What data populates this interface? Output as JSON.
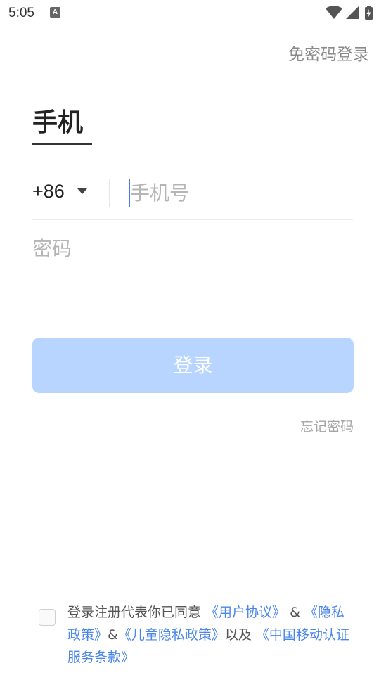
{
  "status_bar": {
    "time": "5:05",
    "notification_icon_letter": "A",
    "icons": [
      "wifi-icon",
      "signal-icon",
      "battery-charging-icon"
    ]
  },
  "header": {
    "alt_login_link": "免密码登录"
  },
  "tab": {
    "title": "手机"
  },
  "phone_row": {
    "country_code": "+86",
    "phone_placeholder": "手机号",
    "phone_value": ""
  },
  "password": {
    "placeholder": "密码",
    "value": ""
  },
  "login_button": {
    "label": "登录"
  },
  "forgot_password": "忘记密码",
  "agreement": {
    "checked": false,
    "prefix": "登录注册代表你已同意 ",
    "user_agreement": "《用户协议》",
    "amp1": " & ",
    "privacy_policy": "《隐私政策》",
    "amp2": "&",
    "child_privacy": "《儿童隐私政策》",
    "and": "以及 ",
    "cmcc_terms": "《中国移动认证服务条款》"
  },
  "colors": {
    "accent": "#4a86e8",
    "button_disabled": "#b8d5ff",
    "muted_text": "#8a8a8a"
  }
}
